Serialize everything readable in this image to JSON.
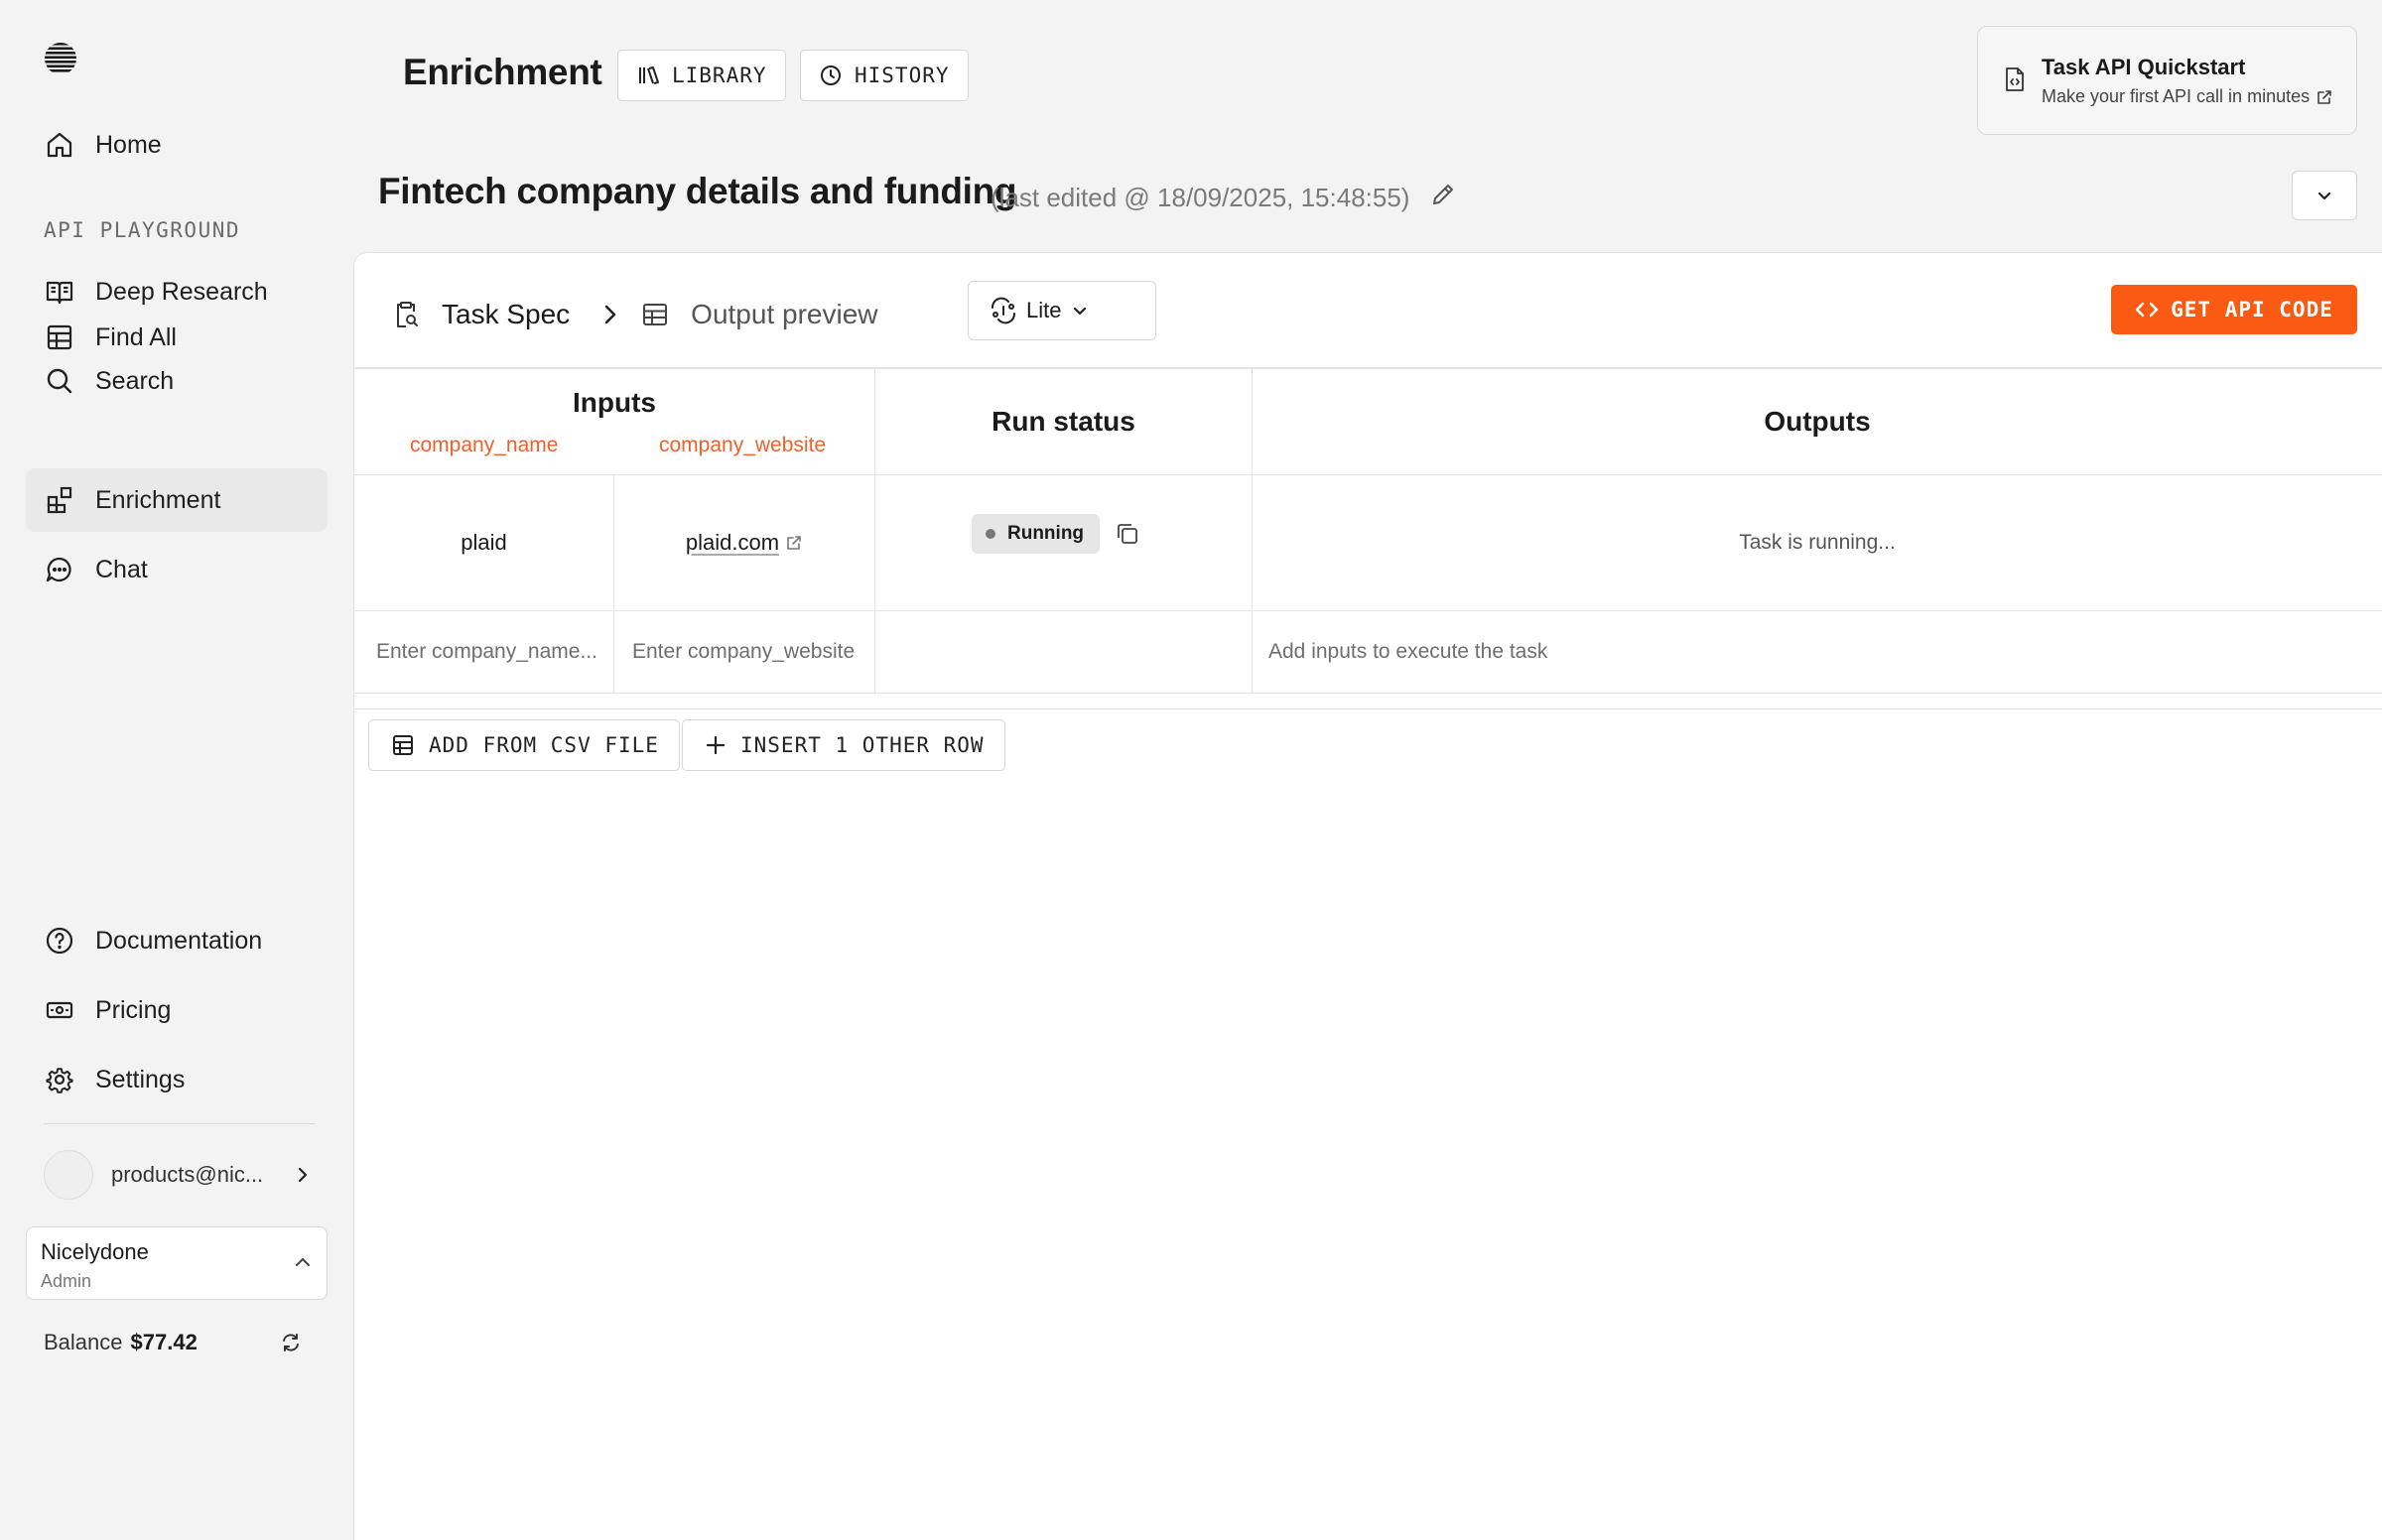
{
  "sidebar": {
    "nav_top": [
      {
        "label": "Home",
        "icon": "home-icon"
      }
    ],
    "section_label": "API PLAYGROUND",
    "nav_playground": [
      {
        "label": "Deep Research",
        "icon": "book-open-icon"
      },
      {
        "label": "Find All",
        "icon": "table-icon"
      },
      {
        "label": "Search",
        "icon": "search-icon"
      },
      {
        "label": "Enrichment",
        "icon": "blocks-icon",
        "active": true
      },
      {
        "label": "Chat",
        "icon": "chat-bubble-icon"
      }
    ],
    "nav_bottom": [
      {
        "label": "Documentation",
        "icon": "help-circle-icon"
      },
      {
        "label": "Pricing",
        "icon": "banknote-icon"
      },
      {
        "label": "Settings",
        "icon": "gear-icon"
      }
    ],
    "user_email": "products@nic...",
    "org": {
      "name": "Nicelydone",
      "role": "Admin"
    },
    "balance": {
      "label": "Balance",
      "amount": "$77.42"
    }
  },
  "header": {
    "title": "Enrichment",
    "library_label": "LIBRARY",
    "history_label": "HISTORY",
    "quickstart": {
      "title": "Task API Quickstart",
      "subtitle": "Make your first API call in minutes"
    }
  },
  "task": {
    "title": "Fintech company details and funding",
    "edited": "(last edited @ 18/09/2025, 15:48:55)"
  },
  "toolbar": {
    "step_spec": "Task Spec",
    "step_preview": "Output preview",
    "processor": "Lite",
    "api_code_label": "GET API CODE"
  },
  "table": {
    "inputs_header": "Inputs",
    "run_status_header": "Run status",
    "outputs_header": "Outputs",
    "columns": [
      "company_name",
      "company_website"
    ],
    "rows": [
      {
        "company_name": "plaid",
        "company_website": "plaid.com",
        "status": "Running",
        "output": "Task is running..."
      }
    ],
    "new_row": {
      "company_name_placeholder": "Enter company_name...",
      "company_website_placeholder": "Enter company_website",
      "output_hint": "Add inputs to execute the task"
    }
  },
  "actions": {
    "add_csv_label": "ADD FROM CSV FILE",
    "insert_row_label": "INSERT 1 OTHER ROW"
  },
  "colors": {
    "accent": "#fb5a12",
    "column_name": "#f0602a"
  }
}
